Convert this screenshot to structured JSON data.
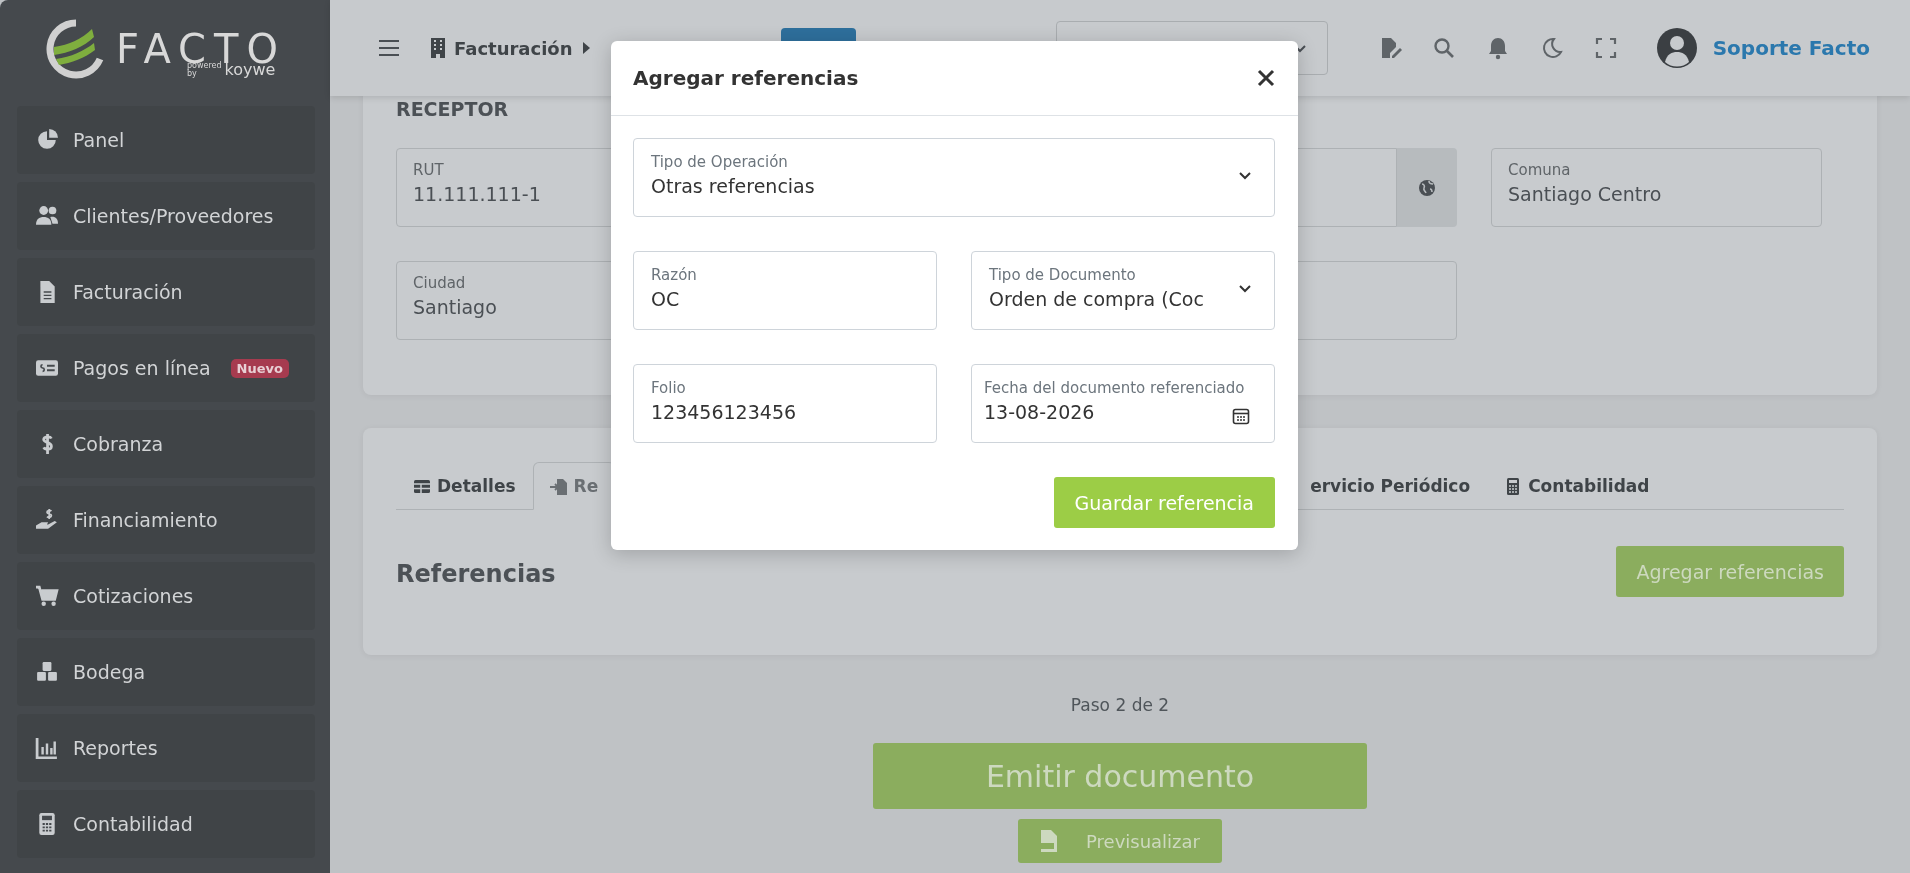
{
  "logo": {
    "name": "FACTO",
    "powered": "powered",
    "by": "by",
    "brand": "koywe"
  },
  "sidebar": {
    "items": [
      {
        "label": "Panel"
      },
      {
        "label": "Clientes/Proveedores"
      },
      {
        "label": "Facturación"
      },
      {
        "label": "Pagos en línea",
        "badge": "Nuevo"
      },
      {
        "label": "Cobranza"
      },
      {
        "label": "Financiamiento"
      },
      {
        "label": "Cotizaciones"
      },
      {
        "label": "Bodega"
      },
      {
        "label": "Reportes"
      },
      {
        "label": "Contabilidad"
      }
    ]
  },
  "topbar": {
    "breadcrumb": "Facturación",
    "user": "Soporte Facto"
  },
  "receptor": {
    "title": "RECEPTOR",
    "fields": [
      {
        "label": "RUT",
        "value": "11.111.111-1"
      },
      {
        "label": "Comuna",
        "value": "Santiago Centro"
      },
      {
        "label": "Ciudad",
        "value": "Santiago"
      }
    ]
  },
  "tabs": [
    {
      "label": "Detalles",
      "selected": false
    },
    {
      "label": "Re",
      "selected": true
    },
    {
      "label": "ervicio Periódico",
      "selected": false
    },
    {
      "label": "Contabilidad",
      "selected": false
    }
  ],
  "references": {
    "title": "Referencias",
    "add_button": "Agregar referencias"
  },
  "step": "Paso 2 de 2",
  "emit_button": "Emitir documento",
  "preview_button": "Previsualizar",
  "modal": {
    "title": "Agregar referencias",
    "fields": [
      {
        "kind": "select",
        "label": "Tipo de Operación",
        "value": "Otras referencias"
      },
      {
        "kind": "text",
        "label": "Razón",
        "value": "OC"
      },
      {
        "kind": "select",
        "label": "Tipo de Documento",
        "value": "Orden de compra (Coc"
      },
      {
        "kind": "text",
        "label": "Folio",
        "value": "123456123456"
      },
      {
        "kind": "date",
        "label": "Fecha del documento referenciado",
        "value": "13-08-2026"
      }
    ],
    "save_button": "Guardar referencia"
  }
}
